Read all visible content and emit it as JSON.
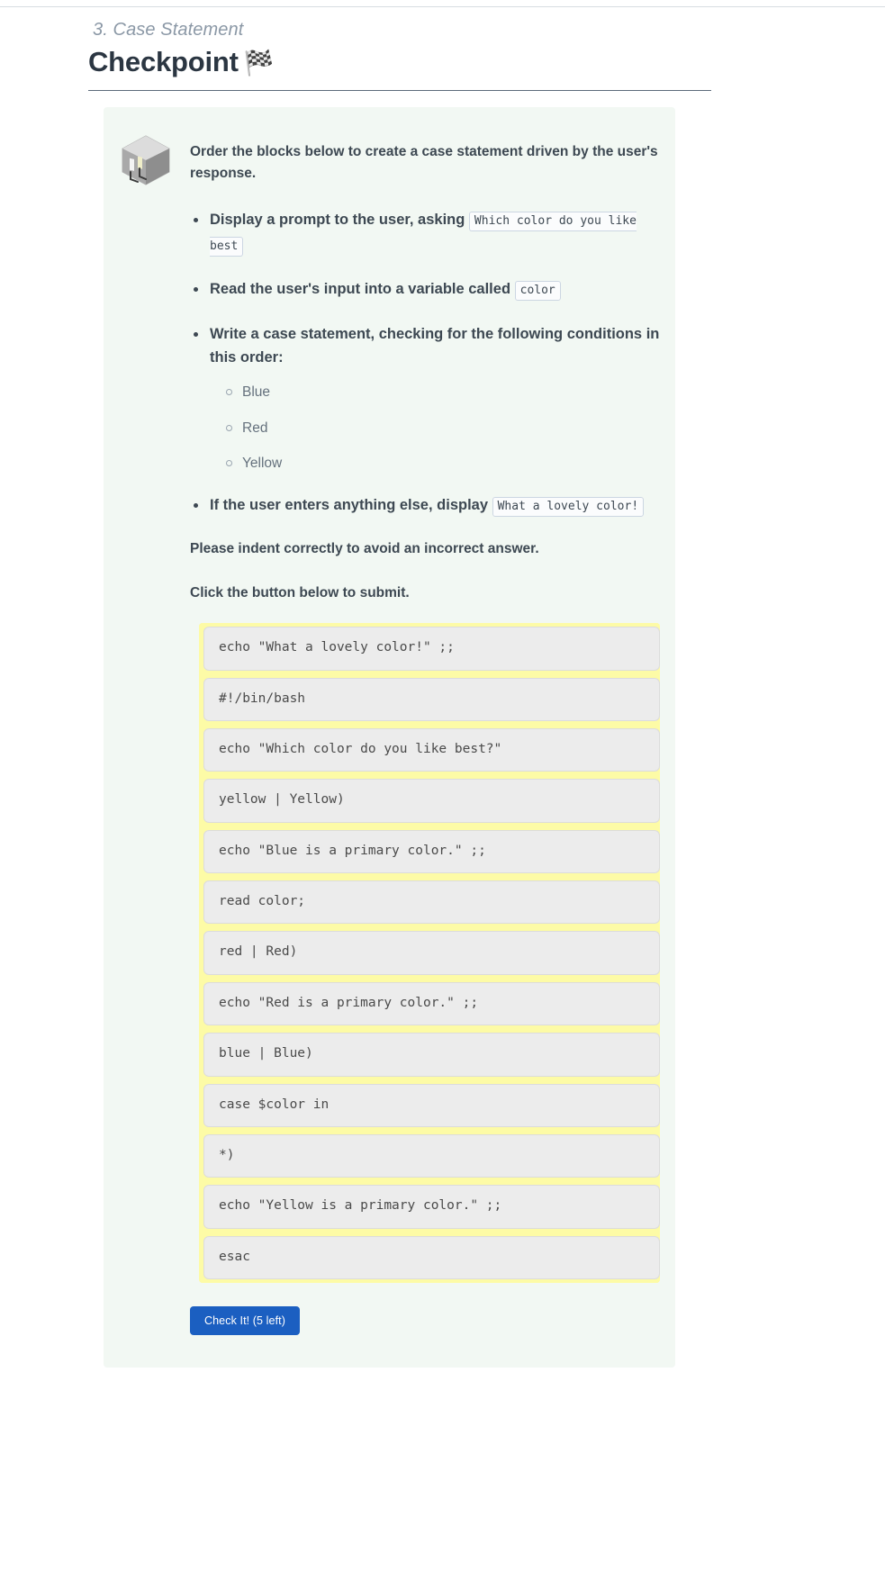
{
  "header": {
    "eyebrow": "3. Case Statement",
    "title": "Checkpoint",
    "flag_icon": "🏁"
  },
  "card": {
    "icon_name": "isometric-box-icon",
    "intro": "Order the blocks below to create a case statement driven by the user's response.",
    "steps": [
      {
        "text_before": "Display a prompt to the user, asking",
        "code": "Which color do you like best",
        "text_after": ""
      },
      {
        "text_before": "Read the user's input into a variable called",
        "code": "color",
        "text_after": ""
      },
      {
        "text_before": "Write a case statement, checking for the following conditions in this order:",
        "code": "",
        "text_after": "",
        "sub_items": [
          "Blue",
          "Red",
          "Yellow"
        ]
      },
      {
        "text_before": "If the user enters anything else, display",
        "code": "What a lovely color!",
        "text_after": ""
      }
    ],
    "note_indent": "Please indent correctly to avoid an incorrect answer.",
    "note_submit": "Click the button below to submit.",
    "blocks": [
      "echo \"What a lovely color!\" ;;",
      "#!/bin/bash",
      "echo \"Which color do you like best?\"",
      "yellow | Yellow)",
      "echo \"Blue is a primary color.\" ;;",
      "read color;",
      "red | Red)",
      "echo \"Red is a primary color.\" ;;",
      "blue | Blue)",
      "case $color in",
      "*)",
      "echo \"Yellow is a primary color.\" ;;",
      "esac"
    ],
    "submit_label": "Check It! (5 left)"
  },
  "colors": {
    "card_background": "#f2f8f3",
    "block_highlight": "#fdfba6",
    "block_background": "#ececec",
    "button_background": "#1b5fc1",
    "title_color": "#2b3642",
    "eyebrow_color": "#8b98a6"
  }
}
